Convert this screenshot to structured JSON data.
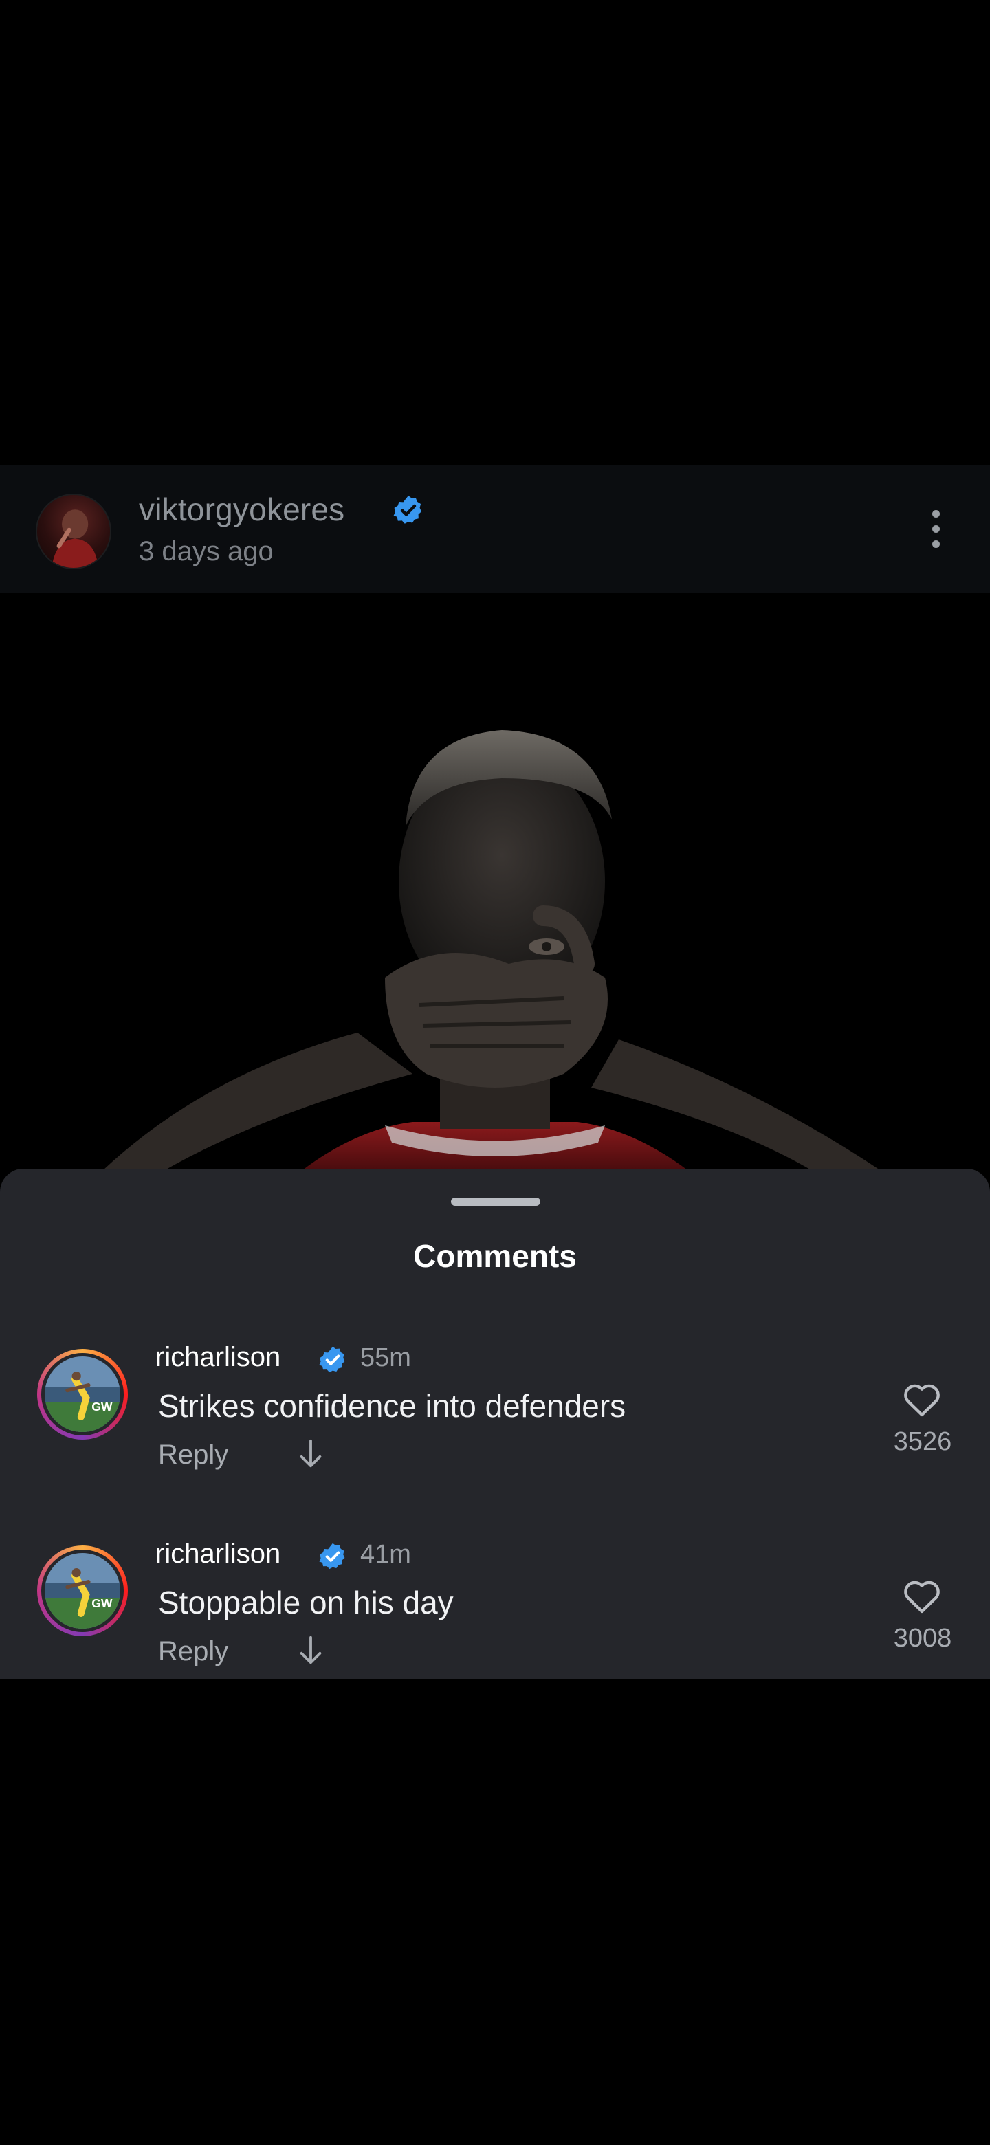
{
  "post": {
    "username": "viktorgyokeres",
    "time": "3 days ago",
    "more_icon": "more-vertical-icon",
    "verified_color": "#3897f0"
  },
  "comments_sheet": {
    "title": "Comments",
    "items": [
      {
        "username": "richarlison",
        "time": "55m",
        "text": "Strikes confidence into defenders",
        "reply_label": "Reply",
        "likes": "3526"
      },
      {
        "username": "richarlison",
        "time": "41m",
        "text": "Stoppable on his day",
        "reply_label": "Reply",
        "likes": "3008"
      }
    ]
  },
  "colors": {
    "background": "#000000",
    "sheet": "#25262b",
    "verified": "#3897f0"
  }
}
